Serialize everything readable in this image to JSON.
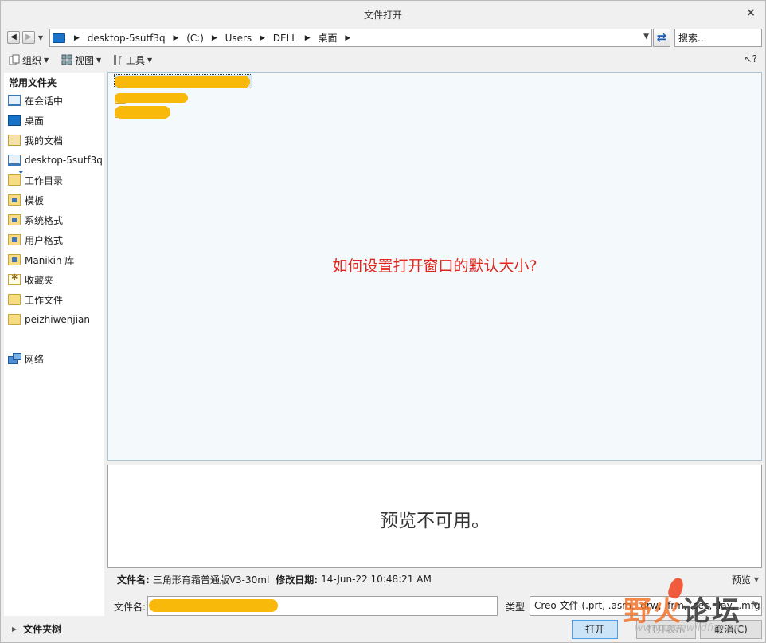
{
  "window": {
    "title": "文件打开",
    "close": "×"
  },
  "nav": {
    "crumbs": [
      "desktop-5sutf3q",
      "(C:)",
      "Users",
      "DELL",
      "桌面"
    ],
    "search_placeholder": "搜索..."
  },
  "toolbar": {
    "organize": "组织",
    "view": "视图",
    "tools": "工具"
  },
  "sidebar": {
    "heading": "常用文件夹",
    "items": [
      {
        "label": "在会话中",
        "icon": "monitor-icon"
      },
      {
        "label": "桌面",
        "icon": "desktop-icon"
      },
      {
        "label": "我的文档",
        "icon": "documents-icon"
      },
      {
        "label": "desktop-5sutf3q",
        "icon": "computer-icon"
      },
      {
        "label": "工作目录",
        "icon": "working-folder-icon"
      },
      {
        "label": "模板",
        "icon": "folder-icon"
      },
      {
        "label": "系统格式",
        "icon": "folder-icon"
      },
      {
        "label": "用户格式",
        "icon": "folder-icon"
      },
      {
        "label": "Manikin 库",
        "icon": "folder-icon"
      },
      {
        "label": "收藏夹",
        "icon": "favorites-icon"
      },
      {
        "label": "工作文件",
        "icon": "folder-icon"
      },
      {
        "label": "peizhiwenjian",
        "icon": "folder-icon"
      }
    ],
    "network": "网络",
    "folder_tree": "文件夹树"
  },
  "overlay_text": "如何设置打开窗口的默认大小?",
  "preview": {
    "message": "预览不可用。"
  },
  "info": {
    "filename_label": "文件名:",
    "filename": "三角形育霜普通版V3-30ml",
    "modified_label": "修改日期:",
    "modified": "14-Jun-22 10:48:21 AM",
    "preview_toggle": "预览"
  },
  "bottom": {
    "filename_label": "文件名:",
    "type_label": "类型",
    "type_value": "Creo 文件 (.prt, .asm, .drw, .frm, .sec, .lay, .mfg...)",
    "open": "打开",
    "open_as": "打开表示",
    "cancel": "取消(C)"
  },
  "watermark": {
    "text_a": "野火",
    "text_b": "论坛",
    "url": "www.proewildfire.cn"
  },
  "colors": {
    "accent": "#1a73c8",
    "overlay": "#e0251d",
    "list_bg": "#f4f9fc",
    "redaction": "#f9b90a"
  }
}
